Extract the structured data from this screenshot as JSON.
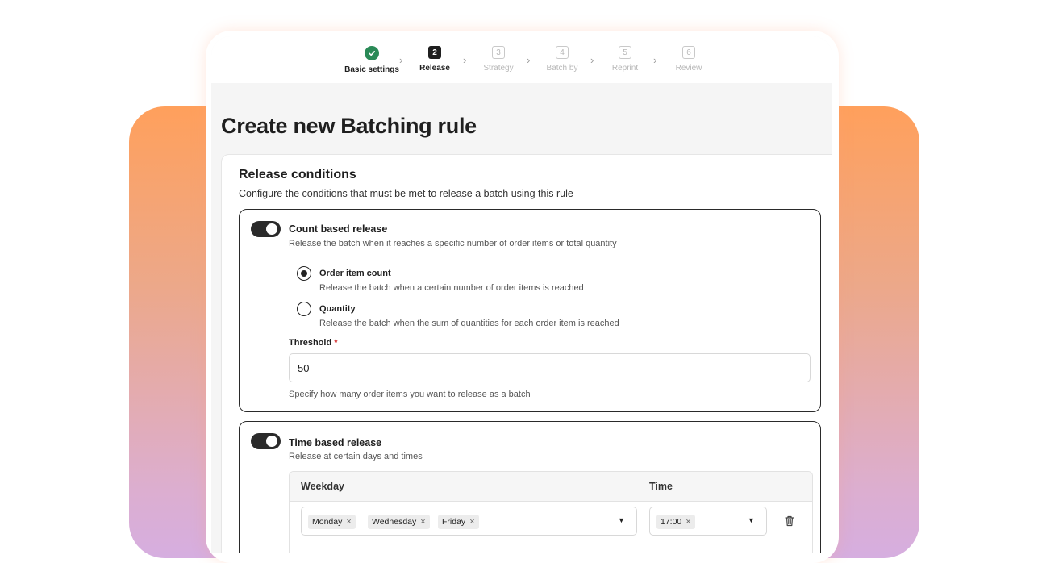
{
  "stepper": {
    "steps": [
      {
        "label": "Basic settings",
        "number": "",
        "status": "done"
      },
      {
        "label": "Release",
        "number": "2",
        "status": "active"
      },
      {
        "label": "Strategy",
        "number": "3",
        "status": "pending"
      },
      {
        "label": "Batch by",
        "number": "4",
        "status": "pending"
      },
      {
        "label": "Reprint",
        "number": "5",
        "status": "pending"
      },
      {
        "label": "Review",
        "number": "6",
        "status": "pending"
      }
    ],
    "separator": "›"
  },
  "page": {
    "title": "Create new Batching rule"
  },
  "release_conditions": {
    "title": "Release conditions",
    "subtitle": "Configure the conditions that must be met to release a batch using this rule"
  },
  "count_release": {
    "enabled": true,
    "title": "Count based release",
    "description": "Release the batch when it reaches a specific number of order items or total quantity",
    "options": [
      {
        "label": "Order item count",
        "description": "Release the batch when a certain number of order items is reached",
        "selected": true
      },
      {
        "label": "Quantity",
        "description": "Release the batch when the sum of quantities for each order item is reached",
        "selected": false
      }
    ],
    "threshold_label": "Threshold",
    "required_mark": "*",
    "threshold_value": "50",
    "threshold_helper": "Specify how many order items you want to release as a batch"
  },
  "time_release": {
    "enabled": true,
    "title": "Time based release",
    "description": "Release at certain days and times",
    "columns": {
      "weekday": "Weekday",
      "time": "Time"
    },
    "row": {
      "weekdays": [
        "Monday",
        "Wednesday",
        "Friday"
      ],
      "times": [
        "17:00"
      ]
    },
    "chip_remove": "×",
    "dropdown_caret": "▼"
  },
  "colors": {
    "success": "#2a8a57",
    "toggle_on": "#2b2b2b",
    "required": "#d32f2f",
    "gradient_top": "#ffa05c",
    "gradient_bottom": "#d6aee0"
  }
}
